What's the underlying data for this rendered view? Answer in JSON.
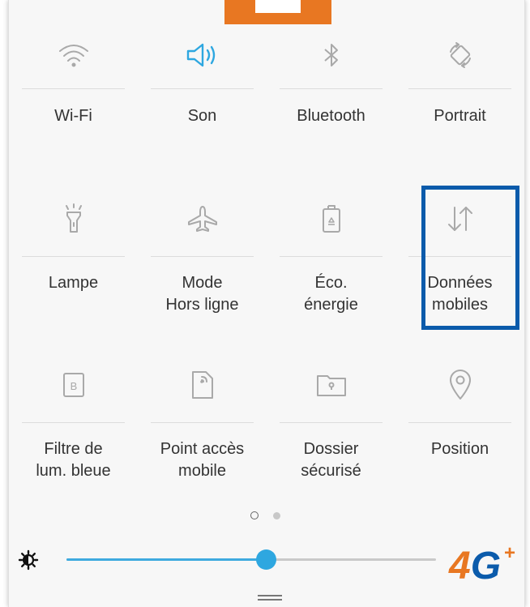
{
  "tiles": [
    {
      "label": "Wi-Fi",
      "icon": "wifi-icon",
      "active": false
    },
    {
      "label": "Son",
      "icon": "speaker-icon",
      "active": true
    },
    {
      "label": "Bluetooth",
      "icon": "bluetooth-icon",
      "active": false
    },
    {
      "label": "Portrait",
      "icon": "rotation-icon",
      "active": false
    },
    {
      "label": "Lampe",
      "icon": "flashlight-icon",
      "active": false
    },
    {
      "label": "Mode\nHors ligne",
      "icon": "airplane-icon",
      "active": false
    },
    {
      "label": "Éco.\nénergie",
      "icon": "battery-recycle-icon",
      "active": false
    },
    {
      "label": "Données\nmobiles",
      "icon": "mobile-data-icon",
      "active": false,
      "highlighted": true
    },
    {
      "label": "Filtre de\nlum. bleue",
      "icon": "blue-light-filter-icon",
      "active": false
    },
    {
      "label": "Point accès\nmobile",
      "icon": "hotspot-icon",
      "active": false
    },
    {
      "label": "Dossier\nsécurisé",
      "icon": "secure-folder-icon",
      "active": false
    },
    {
      "label": "Position",
      "icon": "location-pin-icon",
      "active": false
    }
  ],
  "pager": {
    "current_page": 1,
    "page_count": 2
  },
  "brightness": {
    "level": 0.54
  },
  "logo": {
    "main": "4G",
    "sup": "+"
  },
  "colors": {
    "accent": "#2ea7e0",
    "highlight_border": "#0b5bab",
    "top_tab": "#e87722",
    "icon_inactive": "#a9a9a9",
    "logo_four": "#e87722",
    "logo_g": "#0b5bab"
  }
}
